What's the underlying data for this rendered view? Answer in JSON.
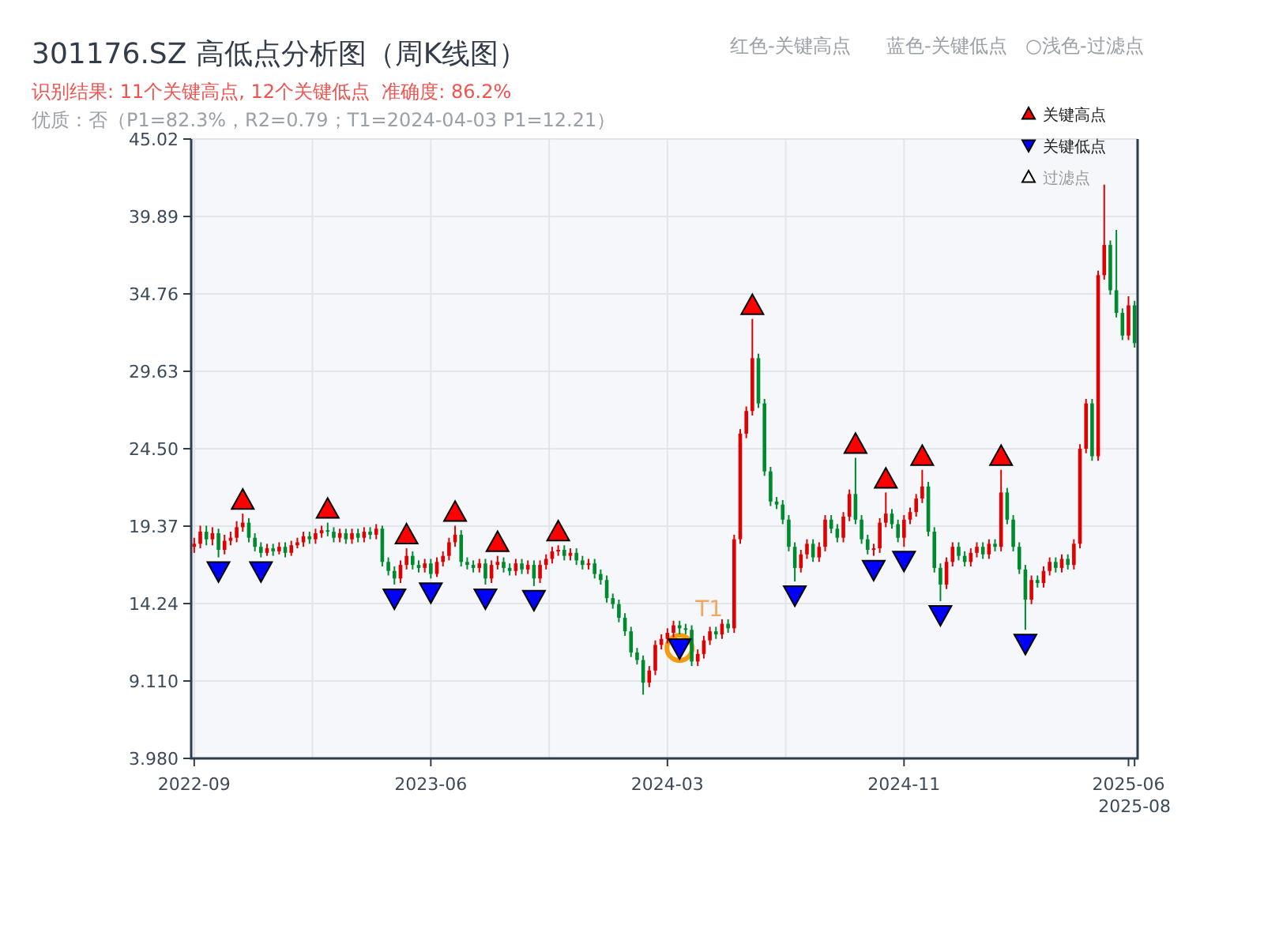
{
  "title": "301176.SZ 高低点分析图（周K线图）",
  "legend_note": [
    "红色-关键高点",
    "蓝色-关键低点",
    "○浅色-过滤点"
  ],
  "result_line": "识别结果: 11个关键高点, 12个关键低点  准确度: 86.2%",
  "quality_line": "优质：否（P1=82.3%，R2=0.79；T1=2024-04-03 P1=12.21）",
  "chart_data": {
    "type": "candlestick",
    "grid": true,
    "legend": "top-right",
    "ylim": [
      3.98,
      45.02
    ],
    "yticks": [
      {
        "value": 3.98,
        "label": "3.980"
      },
      {
        "value": 9.11,
        "label": "9.110"
      },
      {
        "value": 14.24,
        "label": "14.24"
      },
      {
        "value": 19.37,
        "label": "19.37"
      },
      {
        "value": 24.5,
        "label": "24.50"
      },
      {
        "value": 29.63,
        "label": "29.63"
      },
      {
        "value": 34.76,
        "label": "34.76"
      },
      {
        "value": 39.89,
        "label": "39.89"
      },
      {
        "value": 45.02,
        "label": "45.02"
      }
    ],
    "categories": [
      "2022-09",
      null,
      null,
      null,
      null,
      null,
      null,
      null,
      null,
      null,
      null,
      null,
      null,
      null,
      null,
      null,
      null,
      null,
      null,
      null,
      null,
      null,
      null,
      null,
      null,
      null,
      null,
      null,
      null,
      null,
      null,
      null,
      null,
      null,
      null,
      null,
      null,
      null,
      null,
      "2023-06",
      null,
      null,
      null,
      null,
      null,
      null,
      null,
      null,
      null,
      null,
      null,
      null,
      null,
      null,
      null,
      null,
      null,
      null,
      null,
      null,
      null,
      null,
      null,
      null,
      null,
      null,
      null,
      null,
      null,
      null,
      null,
      null,
      null,
      null,
      null,
      null,
      null,
      null,
      "2024-03",
      null,
      null,
      null,
      null,
      null,
      null,
      null,
      null,
      null,
      null,
      null,
      null,
      null,
      null,
      null,
      null,
      null,
      null,
      null,
      null,
      null,
      null,
      null,
      null,
      null,
      null,
      null,
      null,
      null,
      null,
      null,
      null,
      null,
      null,
      null,
      null,
      null,
      null,
      "2024-11",
      null,
      null,
      null,
      null,
      null,
      null,
      null,
      null,
      null,
      null,
      null,
      null,
      null,
      null,
      null,
      null,
      null,
      null,
      null,
      null,
      null,
      null,
      null,
      null,
      null,
      null,
      null,
      null,
      null,
      null,
      null,
      null,
      null,
      null,
      null,
      null,
      "2025-06",
      "2025-08"
    ],
    "ohlc": [
      [
        18.0,
        18.6,
        17.6,
        18.2
      ],
      [
        18.2,
        19.4,
        17.9,
        19.0
      ],
      [
        19.0,
        19.4,
        18.1,
        18.5
      ],
      [
        18.5,
        19.3,
        18.1,
        18.9
      ],
      [
        18.9,
        19.2,
        17.3,
        17.8
      ],
      [
        17.8,
        18.8,
        17.5,
        18.4
      ],
      [
        18.4,
        19.0,
        18.1,
        18.6
      ],
      [
        18.6,
        19.7,
        18.3,
        19.3
      ],
      [
        19.3,
        20.2,
        19.0,
        19.6
      ],
      [
        19.6,
        19.9,
        18.3,
        18.6
      ],
      [
        18.6,
        18.9,
        17.7,
        18.0
      ],
      [
        18.0,
        18.3,
        17.3,
        17.6
      ],
      [
        17.6,
        18.2,
        17.4,
        17.9
      ],
      [
        17.9,
        18.2,
        17.4,
        17.7
      ],
      [
        17.7,
        18.3,
        17.5,
        18.0
      ],
      [
        18.0,
        18.3,
        17.3,
        17.6
      ],
      [
        17.6,
        18.4,
        17.4,
        18.1
      ],
      [
        18.1,
        18.6,
        17.9,
        18.3
      ],
      [
        18.3,
        19.0,
        18.0,
        18.7
      ],
      [
        18.7,
        19.0,
        18.2,
        18.5
      ],
      [
        18.5,
        19.2,
        18.2,
        18.9
      ],
      [
        18.9,
        19.4,
        18.6,
        19.1
      ],
      [
        19.1,
        19.6,
        18.7,
        19.0
      ],
      [
        19.0,
        19.3,
        18.3,
        18.6
      ],
      [
        18.6,
        19.2,
        18.3,
        18.9
      ],
      [
        18.9,
        19.2,
        18.2,
        18.5
      ],
      [
        18.5,
        19.2,
        18.2,
        18.9
      ],
      [
        18.9,
        19.2,
        18.3,
        18.6
      ],
      [
        18.6,
        19.3,
        18.3,
        19.0
      ],
      [
        19.0,
        19.3,
        18.5,
        18.8
      ],
      [
        18.8,
        19.5,
        18.5,
        19.2
      ],
      [
        19.2,
        19.4,
        16.7,
        17.0
      ],
      [
        17.0,
        17.3,
        16.1,
        16.4
      ],
      [
        16.4,
        16.7,
        15.5,
        15.9
      ],
      [
        15.9,
        17.1,
        15.6,
        16.8
      ],
      [
        16.8,
        17.9,
        16.5,
        17.4
      ],
      [
        17.4,
        17.7,
        16.5,
        16.8
      ],
      [
        16.8,
        17.1,
        16.3,
        16.6
      ],
      [
        16.6,
        17.2,
        16.3,
        16.9
      ],
      [
        16.9,
        17.2,
        15.9,
        16.2
      ],
      [
        16.2,
        17.3,
        16.0,
        17.0
      ],
      [
        17.0,
        17.7,
        16.7,
        17.4
      ],
      [
        17.4,
        18.6,
        17.1,
        18.3
      ],
      [
        18.3,
        19.4,
        18.0,
        18.8
      ],
      [
        18.8,
        19.1,
        16.7,
        17.0
      ],
      [
        17.0,
        17.3,
        16.5,
        16.8
      ],
      [
        16.8,
        17.1,
        16.3,
        16.6
      ],
      [
        16.6,
        17.2,
        16.3,
        16.9
      ],
      [
        16.9,
        17.2,
        15.5,
        15.9
      ],
      [
        15.9,
        17.1,
        15.6,
        16.8
      ],
      [
        16.8,
        17.4,
        16.5,
        17.0
      ],
      [
        17.0,
        17.3,
        16.3,
        16.6
      ],
      [
        16.6,
        16.9,
        16.1,
        16.4
      ],
      [
        16.4,
        17.2,
        16.1,
        16.9
      ],
      [
        16.9,
        17.2,
        16.2,
        16.5
      ],
      [
        16.5,
        17.1,
        16.2,
        16.8
      ],
      [
        16.8,
        17.1,
        15.4,
        15.9
      ],
      [
        15.9,
        17.1,
        15.6,
        16.8
      ],
      [
        16.8,
        17.5,
        16.5,
        17.2
      ],
      [
        17.2,
        18.0,
        16.9,
        17.7
      ],
      [
        17.7,
        18.1,
        17.4,
        17.8
      ],
      [
        17.8,
        18.1,
        17.1,
        17.4
      ],
      [
        17.4,
        17.9,
        17.1,
        17.6
      ],
      [
        17.6,
        17.9,
        16.8,
        17.1
      ],
      [
        17.1,
        17.4,
        16.5,
        16.8
      ],
      [
        16.8,
        17.2,
        16.5,
        16.9
      ],
      [
        16.9,
        17.2,
        15.9,
        16.2
      ],
      [
        16.2,
        16.5,
        15.5,
        15.8
      ],
      [
        15.8,
        16.1,
        14.3,
        14.6
      ],
      [
        14.6,
        14.9,
        13.9,
        14.2
      ],
      [
        14.2,
        14.5,
        13.0,
        13.3
      ],
      [
        13.3,
        13.6,
        12.1,
        12.4
      ],
      [
        12.4,
        12.7,
        10.7,
        11.0
      ],
      [
        11.0,
        11.3,
        10.2,
        10.5
      ],
      [
        10.5,
        10.8,
        8.2,
        9.0
      ],
      [
        9.0,
        10.1,
        8.7,
        9.8
      ],
      [
        9.8,
        11.8,
        9.5,
        11.5
      ],
      [
        11.5,
        12.2,
        11.2,
        11.9
      ],
      [
        11.9,
        12.6,
        11.6,
        12.3
      ],
      [
        12.3,
        13.1,
        12.0,
        12.8
      ],
      [
        12.8,
        13.1,
        12.2,
        12.6
      ],
      [
        12.6,
        12.9,
        12.2,
        12.5
      ],
      [
        12.5,
        12.8,
        10.1,
        10.4
      ],
      [
        10.4,
        11.2,
        10.1,
        10.9
      ],
      [
        10.9,
        12.1,
        10.6,
        11.8
      ],
      [
        11.8,
        12.7,
        11.5,
        12.4
      ],
      [
        12.4,
        12.7,
        11.9,
        12.2
      ],
      [
        12.2,
        13.2,
        11.9,
        12.9
      ],
      [
        12.9,
        13.2,
        12.3,
        12.6
      ],
      [
        12.6,
        18.8,
        12.3,
        18.5
      ],
      [
        18.5,
        25.8,
        18.2,
        25.5
      ],
      [
        25.5,
        27.3,
        25.2,
        27.0
      ],
      [
        27.0,
        33.1,
        26.7,
        30.5
      ],
      [
        30.5,
        30.8,
        27.2,
        27.5
      ],
      [
        27.5,
        27.8,
        22.7,
        23.0
      ],
      [
        23.0,
        23.3,
        20.7,
        21.0
      ],
      [
        21.0,
        21.3,
        20.5,
        20.8
      ],
      [
        20.8,
        21.1,
        19.5,
        19.8
      ],
      [
        19.8,
        20.1,
        17.7,
        18.0
      ],
      [
        18.0,
        18.3,
        15.7,
        16.6
      ],
      [
        16.6,
        17.8,
        16.3,
        17.5
      ],
      [
        17.5,
        18.5,
        17.2,
        18.2
      ],
      [
        18.2,
        18.5,
        17.0,
        17.3
      ],
      [
        17.3,
        18.3,
        17.0,
        18.0
      ],
      [
        18.0,
        20.1,
        17.7,
        19.8
      ],
      [
        19.8,
        20.1,
        18.9,
        19.2
      ],
      [
        19.2,
        19.5,
        18.3,
        18.6
      ],
      [
        18.6,
        20.3,
        18.3,
        20.0
      ],
      [
        20.0,
        21.8,
        19.7,
        21.5
      ],
      [
        21.5,
        23.9,
        19.5,
        19.8
      ],
      [
        19.8,
        20.1,
        18.2,
        18.5
      ],
      [
        18.5,
        18.8,
        17.5,
        17.8
      ],
      [
        17.8,
        18.2,
        17.4,
        17.9
      ],
      [
        17.9,
        19.9,
        17.6,
        19.6
      ],
      [
        19.6,
        21.6,
        19.3,
        20.2
      ],
      [
        20.2,
        20.5,
        19.2,
        19.5
      ],
      [
        19.5,
        19.8,
        18.3,
        18.6
      ],
      [
        18.6,
        20.1,
        18.0,
        19.8
      ],
      [
        19.8,
        20.6,
        19.5,
        20.3
      ],
      [
        20.3,
        21.5,
        20.0,
        21.2
      ],
      [
        21.2,
        23.1,
        20.9,
        22.0
      ],
      [
        22.0,
        22.3,
        18.7,
        19.0
      ],
      [
        19.0,
        19.3,
        16.3,
        16.6
      ],
      [
        16.6,
        16.9,
        14.4,
        15.5
      ],
      [
        15.5,
        17.3,
        15.2,
        17.0
      ],
      [
        17.0,
        18.3,
        16.7,
        18.0
      ],
      [
        18.0,
        18.3,
        17.1,
        17.4
      ],
      [
        17.4,
        17.7,
        16.7,
        17.0
      ],
      [
        17.0,
        17.9,
        16.7,
        17.6
      ],
      [
        17.6,
        18.3,
        17.3,
        18.0
      ],
      [
        18.0,
        18.3,
        17.2,
        17.5
      ],
      [
        17.5,
        18.5,
        17.2,
        18.2
      ],
      [
        18.2,
        18.5,
        17.7,
        18.0
      ],
      [
        18.0,
        23.1,
        17.7,
        21.6
      ],
      [
        21.6,
        21.9,
        19.5,
        19.8
      ],
      [
        19.8,
        20.1,
        17.7,
        18.0
      ],
      [
        18.0,
        18.3,
        16.2,
        16.5
      ],
      [
        16.5,
        16.8,
        12.5,
        14.5
      ],
      [
        14.5,
        16.1,
        14.2,
        15.8
      ],
      [
        15.8,
        16.1,
        15.3,
        15.6
      ],
      [
        15.6,
        16.7,
        15.3,
        16.4
      ],
      [
        16.4,
        17.3,
        16.1,
        17.0
      ],
      [
        17.0,
        17.3,
        16.3,
        16.6
      ],
      [
        16.6,
        17.5,
        16.3,
        17.2
      ],
      [
        17.2,
        17.5,
        16.5,
        16.8
      ],
      [
        16.8,
        18.5,
        16.5,
        18.2
      ],
      [
        18.2,
        24.8,
        17.9,
        24.5
      ],
      [
        24.5,
        27.8,
        24.2,
        27.5
      ],
      [
        27.5,
        27.8,
        23.7,
        24.0
      ],
      [
        24.0,
        36.3,
        23.7,
        36.0
      ],
      [
        36.0,
        42.0,
        35.7,
        38.0
      ],
      [
        38.0,
        38.3,
        34.7,
        35.0
      ],
      [
        35.0,
        39.0,
        33.2,
        33.5
      ],
      [
        33.5,
        33.8,
        31.7,
        32.0
      ],
      [
        32.0,
        34.6,
        31.7,
        34.0
      ],
      [
        34.0,
        34.3,
        31.2,
        31.5
      ]
    ],
    "series": [
      {
        "name": "关键高点",
        "type": "scatter",
        "marker": "triangle-up",
        "color": "#ff0000",
        "values": [
          null,
          null,
          null,
          null,
          null,
          null,
          null,
          null,
          21.1,
          null,
          null,
          null,
          null,
          null,
          null,
          null,
          null,
          null,
          null,
          null,
          null,
          null,
          20.5,
          null,
          null,
          null,
          null,
          null,
          null,
          null,
          null,
          null,
          null,
          null,
          null,
          18.8,
          null,
          null,
          null,
          null,
          null,
          null,
          null,
          20.3,
          null,
          null,
          null,
          null,
          null,
          null,
          18.3,
          null,
          null,
          null,
          null,
          null,
          null,
          null,
          null,
          null,
          19.0,
          null,
          null,
          null,
          null,
          null,
          null,
          null,
          null,
          null,
          null,
          null,
          null,
          null,
          null,
          null,
          null,
          null,
          null,
          null,
          null,
          null,
          null,
          null,
          null,
          null,
          null,
          null,
          null,
          null,
          null,
          null,
          34.0,
          null,
          null,
          null,
          null,
          null,
          null,
          null,
          null,
          null,
          null,
          null,
          null,
          null,
          null,
          null,
          null,
          24.8,
          null,
          null,
          null,
          null,
          22.5,
          null,
          null,
          null,
          null,
          null,
          24.0,
          null,
          null,
          null,
          null,
          null,
          null,
          null,
          null,
          null,
          null,
          null,
          null,
          24.0,
          null,
          null,
          null,
          null,
          null,
          null,
          null,
          null,
          null,
          null,
          null,
          null,
          null,
          null,
          null,
          null,
          null,
          null,
          null,
          null,
          null,
          null
        ]
      },
      {
        "name": "关键低点",
        "type": "scatter",
        "marker": "triangle-down",
        "color": "#0000ff",
        "values": [
          null,
          null,
          null,
          null,
          16.4,
          null,
          null,
          null,
          null,
          null,
          null,
          16.4,
          null,
          null,
          null,
          null,
          null,
          null,
          null,
          null,
          null,
          null,
          null,
          null,
          null,
          null,
          null,
          null,
          null,
          null,
          null,
          null,
          null,
          14.6,
          null,
          null,
          null,
          null,
          null,
          15.0,
          null,
          null,
          null,
          null,
          null,
          null,
          null,
          null,
          14.6,
          null,
          null,
          null,
          null,
          null,
          null,
          null,
          14.5,
          null,
          null,
          null,
          null,
          null,
          null,
          null,
          null,
          null,
          null,
          null,
          null,
          null,
          null,
          null,
          null,
          null,
          null,
          null,
          null,
          null,
          null,
          null,
          11.3,
          null,
          null,
          null,
          null,
          null,
          null,
          null,
          null,
          null,
          null,
          null,
          null,
          null,
          null,
          null,
          null,
          null,
          null,
          14.8,
          null,
          null,
          null,
          null,
          null,
          null,
          null,
          null,
          null,
          null,
          null,
          null,
          16.5,
          null,
          null,
          null,
          null,
          17.1,
          null,
          null,
          null,
          null,
          null,
          13.5,
          null,
          null,
          null,
          null,
          null,
          null,
          null,
          null,
          null,
          null,
          null,
          null,
          null,
          11.6,
          null,
          null,
          null,
          null,
          null,
          null,
          null,
          null,
          null,
          null,
          null,
          null,
          null,
          null,
          null,
          null,
          null,
          null
        ]
      },
      {
        "name": "过滤点",
        "type": "scatter",
        "marker": "triangle-up",
        "color": "#ffffff",
        "values": [
          null,
          null,
          null,
          null,
          null,
          null,
          null,
          null,
          null,
          null,
          null,
          null,
          null,
          null,
          null,
          null,
          null,
          null,
          null,
          null,
          null,
          null,
          null,
          null,
          null,
          null,
          null,
          null,
          null,
          null,
          null,
          null,
          null,
          null,
          null,
          null,
          null,
          null,
          null,
          null,
          null,
          null,
          null,
          null,
          null,
          null,
          null,
          null,
          null,
          null,
          null,
          null,
          null,
          null,
          null,
          null,
          null,
          null,
          null,
          null,
          null,
          null,
          null,
          null,
          null,
          null,
          null,
          null,
          null,
          null,
          null,
          null,
          null,
          null,
          null,
          null,
          null,
          null,
          null,
          null,
          null,
          null,
          null,
          null,
          null,
          null,
          null,
          null,
          null,
          null,
          null,
          null,
          null,
          null,
          null,
          null,
          null,
          null,
          null,
          null,
          null,
          null,
          null,
          null,
          null,
          null,
          null,
          null,
          null,
          null,
          null,
          null,
          null,
          null,
          null,
          null,
          null,
          null,
          null,
          null,
          null,
          null,
          null,
          null,
          null,
          null,
          null,
          null,
          null,
          null,
          null,
          null,
          null,
          null,
          null,
          null,
          null,
          null,
          null,
          null,
          null,
          null,
          null,
          null,
          null,
          null,
          null,
          null,
          null,
          null,
          null,
          null,
          null,
          null,
          null,
          null
        ]
      }
    ],
    "annotations": [
      {
        "text": "T1",
        "y": 11.3
      }
    ]
  }
}
